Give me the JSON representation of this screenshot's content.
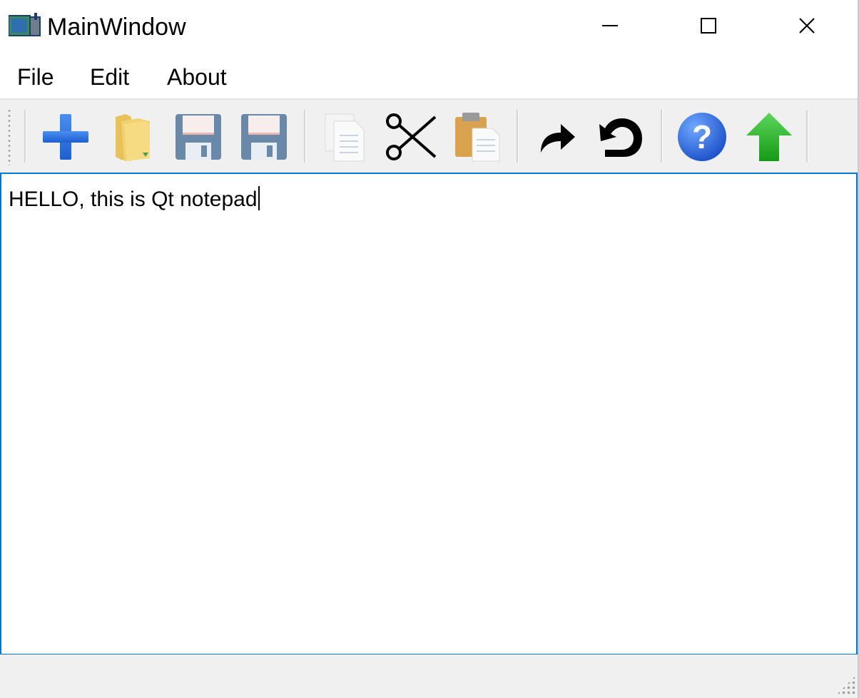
{
  "window": {
    "title": "MainWindow",
    "controls": {
      "minimize": "minimize-icon",
      "maximize": "maximize-icon",
      "close": "close-icon"
    }
  },
  "menu": {
    "items": [
      {
        "label": "File"
      },
      {
        "label": "Edit"
      },
      {
        "label": "About"
      }
    ]
  },
  "toolbar": {
    "buttons": [
      {
        "icon": "new-icon"
      },
      {
        "icon": "open-folder-icon"
      },
      {
        "icon": "save-icon"
      },
      {
        "icon": "save-as-icon"
      },
      {
        "icon": "copy-icon"
      },
      {
        "icon": "cut-icon"
      },
      {
        "icon": "paste-icon"
      },
      {
        "icon": "redo-icon"
      },
      {
        "icon": "undo-icon"
      },
      {
        "icon": "help-icon"
      },
      {
        "icon": "upload-icon"
      }
    ]
  },
  "editor": {
    "content": "HELLO, this is Qt notepad"
  },
  "colors": {
    "accent": "#0078d7",
    "toolbar_bg": "#f0f0f0"
  }
}
